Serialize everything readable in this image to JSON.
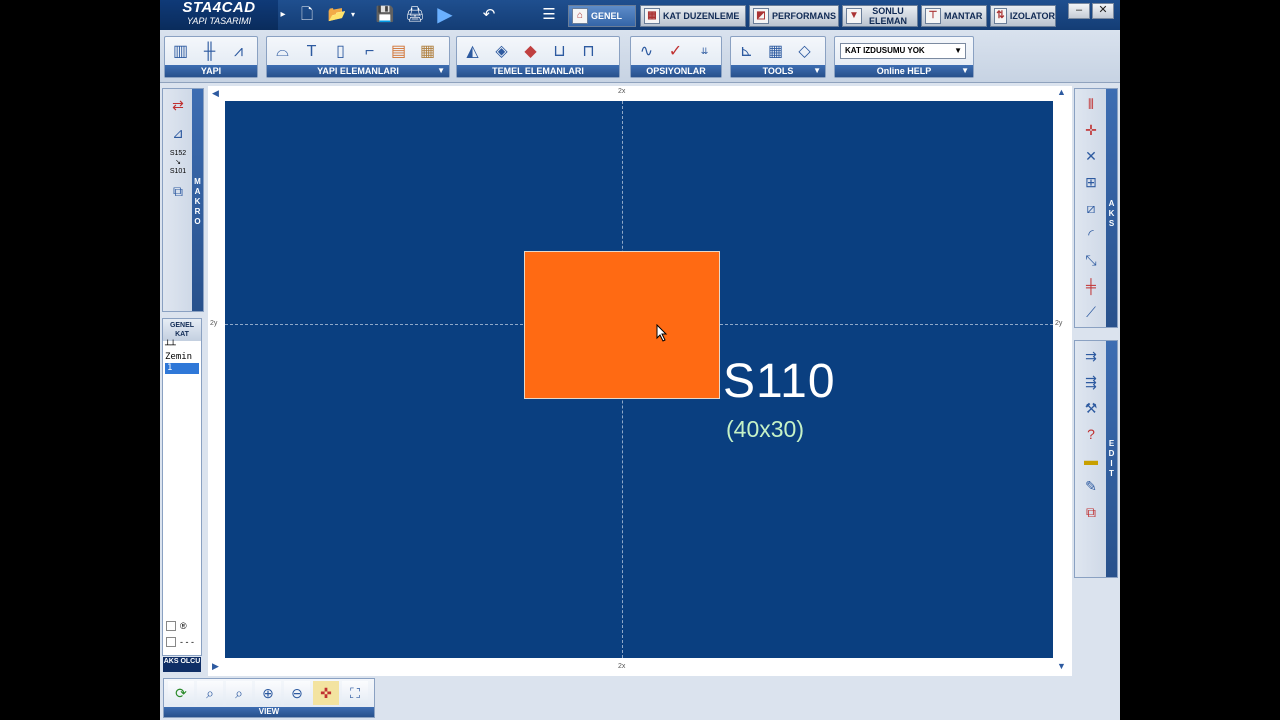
{
  "app": {
    "logo_title": "STA4CAD",
    "logo_subtitle": "YAPI TASARIMI"
  },
  "tabs": [
    {
      "label": "GENEL",
      "icon": "home-icon"
    },
    {
      "label": "KAT DUZENLEME",
      "icon": "floor-plan-icon"
    },
    {
      "label": "PERFORMANS",
      "icon": "chart-icon"
    },
    {
      "label": "SONLU ELEMAN",
      "icon": "mesh-icon"
    },
    {
      "label": "MANTAR",
      "icon": "mushroom-slab-icon"
    },
    {
      "label": "IZOLATOR",
      "icon": "isolator-icon"
    }
  ],
  "ribbon": {
    "groups": [
      {
        "label": "YAPI"
      },
      {
        "label": "YAPI ELEMANLARI"
      },
      {
        "label": "TEMEL ELEMANLARI"
      },
      {
        "label": "OPSIYONLAR"
      },
      {
        "label": "TOOLS"
      },
      {
        "label": "Online HELP"
      }
    ],
    "kat_izdusumu": "KAT IZDUSUMU YOK"
  },
  "left_panel": {
    "strip_label": "MAKRO",
    "kat_header": "GENEL KAT",
    "kat_items": [
      "┴┴",
      "Zemin",
      "1"
    ],
    "selected_kat": "1",
    "checkbox1_label": "®",
    "checkbox2_label": "- - -",
    "aks_olcu": "AKS OLCU"
  },
  "canvas": {
    "bg_color": "#0a3f80",
    "axis_x_label": "2x",
    "axis_y_label": "2y",
    "column": {
      "name": "S110",
      "dimensions": "(40x30)",
      "color": "#ff6a13"
    }
  },
  "right_panel": {
    "aks_label": "AKS",
    "edit_label": "EDIT"
  },
  "view_bar": {
    "label": "VIEW"
  }
}
